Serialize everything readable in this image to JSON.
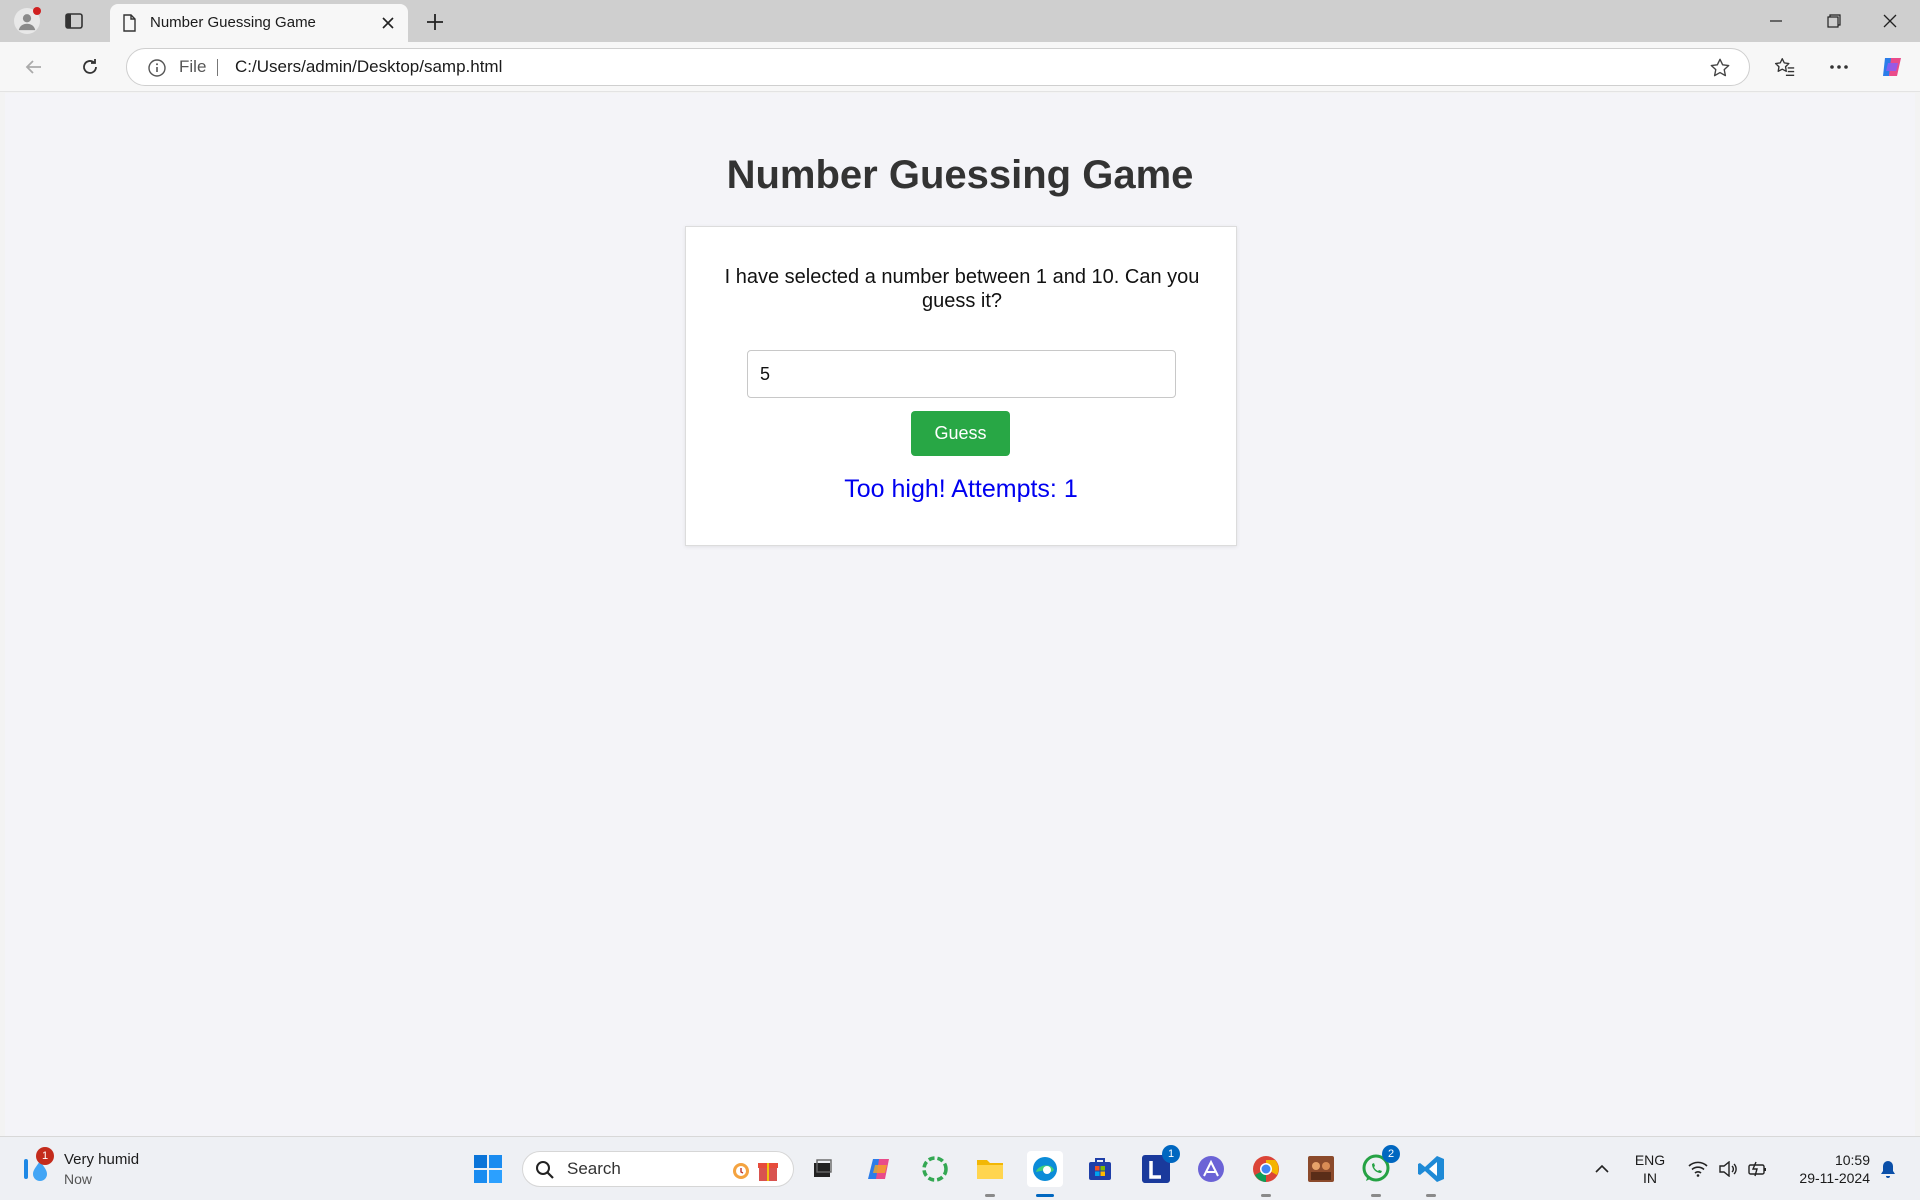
{
  "browser": {
    "tab_title": "Number Guessing Game",
    "address_scheme": "File",
    "address_url": "C:/Users/admin/Desktop/samp.html"
  },
  "game": {
    "heading": "Number Guessing Game",
    "prompt": "I have selected a number between 1 and 10. Can you guess it?",
    "input_value": "5",
    "button_label": "Guess",
    "result": "Too high! Attempts: 1",
    "result_color": "#0000f0",
    "button_color": "#28a745"
  },
  "taskbar": {
    "weather_title": "Very humid",
    "weather_sub": "Now",
    "weather_badge": "1",
    "search_placeholder": "Search",
    "lang_line1": "ENG",
    "lang_line2": "IN",
    "time": "10:59",
    "date": "29-11-2024",
    "pinned": [
      {
        "name": "start",
        "icon": "windows-logo"
      },
      {
        "name": "task-view",
        "icon": "task-view-icon"
      },
      {
        "name": "copilot",
        "icon": "copilot-icon"
      },
      {
        "name": "app-ring",
        "icon": "ring-icon"
      },
      {
        "name": "file-explorer",
        "icon": "folder-icon"
      },
      {
        "name": "edge",
        "icon": "edge-icon"
      },
      {
        "name": "store",
        "icon": "store-icon"
      },
      {
        "name": "l-app",
        "icon": "l-app-icon",
        "badge": "1"
      },
      {
        "name": "vector-app",
        "icon": "vector-icon"
      },
      {
        "name": "chrome",
        "icon": "chrome-icon"
      },
      {
        "name": "photo-app",
        "icon": "photo-icon"
      },
      {
        "name": "whatsapp",
        "icon": "whatsapp-icon",
        "badge": "2"
      },
      {
        "name": "vscode",
        "icon": "vscode-icon"
      }
    ]
  }
}
